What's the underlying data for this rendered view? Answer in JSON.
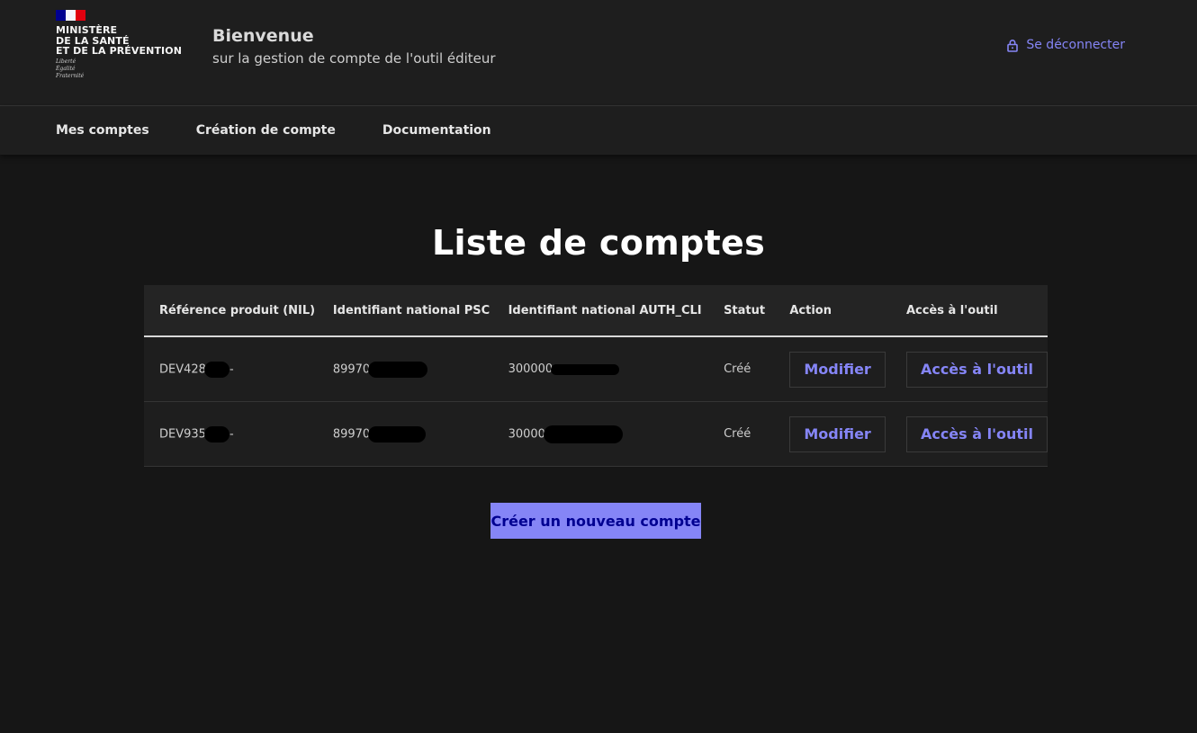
{
  "header": {
    "ministry_name": "MINISTÈRE\nDE LA SANTÉ\nET DE LA PRÉVENTION",
    "motto": "Liberté\nÉgalité\nFraternité",
    "welcome_title": "Bienvenue",
    "welcome_subtitle": "sur la gestion de compte de l'outil éditeur",
    "logout_label": "Se déconnecter"
  },
  "nav": {
    "items": [
      {
        "label": "Mes comptes"
      },
      {
        "label": "Création de compte"
      },
      {
        "label": "Documentation"
      }
    ]
  },
  "main": {
    "title": "Liste de comptes",
    "create_button": "Créer un nouveau compte"
  },
  "table": {
    "columns": [
      "Référence produit (NIL)",
      "Identifiant national PSC",
      "Identifiant national AUTH_CLI",
      "Statut",
      "Action",
      "Accès à l'outil"
    ],
    "rows": [
      {
        "ref": "DEV428",
        "ref_tail": "-",
        "psc": "89970",
        "auth": "300000",
        "status": "Créé",
        "action": "Modifier",
        "access": "Accès à l'outil"
      },
      {
        "ref": "DEV935",
        "ref_tail": "-",
        "psc": "89970",
        "auth": "30000",
        "status": "Créé",
        "action": "Modifier",
        "access": "Accès à l'outil"
      }
    ]
  },
  "colors": {
    "accent": "#8585f6",
    "background": "#161616",
    "header_bg": "#1e1e1e"
  }
}
